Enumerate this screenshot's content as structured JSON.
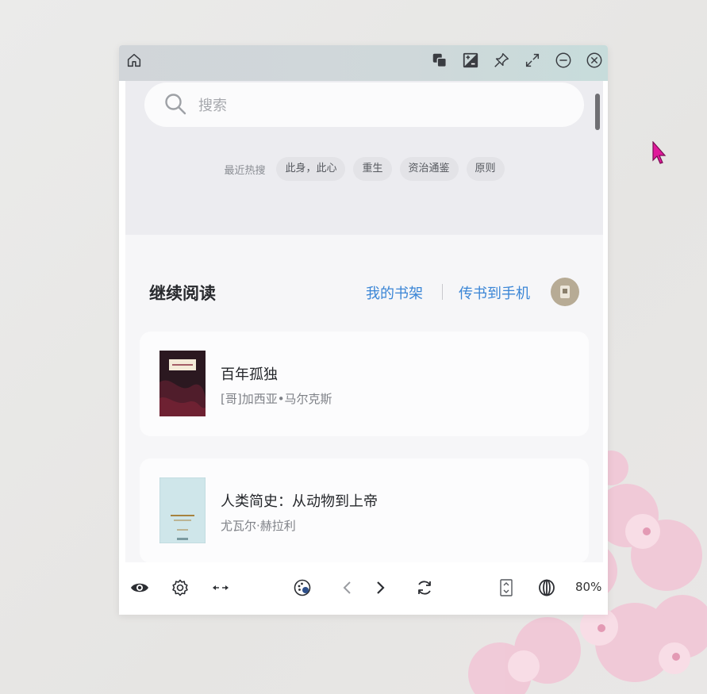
{
  "window": {
    "titlebar_icons": [
      "home-icon",
      "copy-icon",
      "contrast-icon",
      "pin-icon",
      "expand-icon",
      "minimize-icon",
      "close-icon"
    ]
  },
  "search": {
    "placeholder": "搜索"
  },
  "hot_search": {
    "label": "最近热搜",
    "items": [
      "此身，此心",
      "重生",
      "资治通鉴",
      "原则"
    ]
  },
  "continue_reading": {
    "title": "继续阅读",
    "my_shelf": "我的书架",
    "send_to_phone": "传书到手机"
  },
  "books": [
    {
      "title": "百年孤独",
      "author": "[哥]加西亚•马尔克斯",
      "cover_color": "#2b1820"
    },
    {
      "title": "人类简史：从动物到上帝",
      "author": "尤瓦尔·赫拉利",
      "cover_color": "#cfe6ea"
    }
  ],
  "bottombar": {
    "zoom": "80%"
  },
  "colors": {
    "accent": "#3b86d6",
    "cursor": "#e0199a"
  }
}
